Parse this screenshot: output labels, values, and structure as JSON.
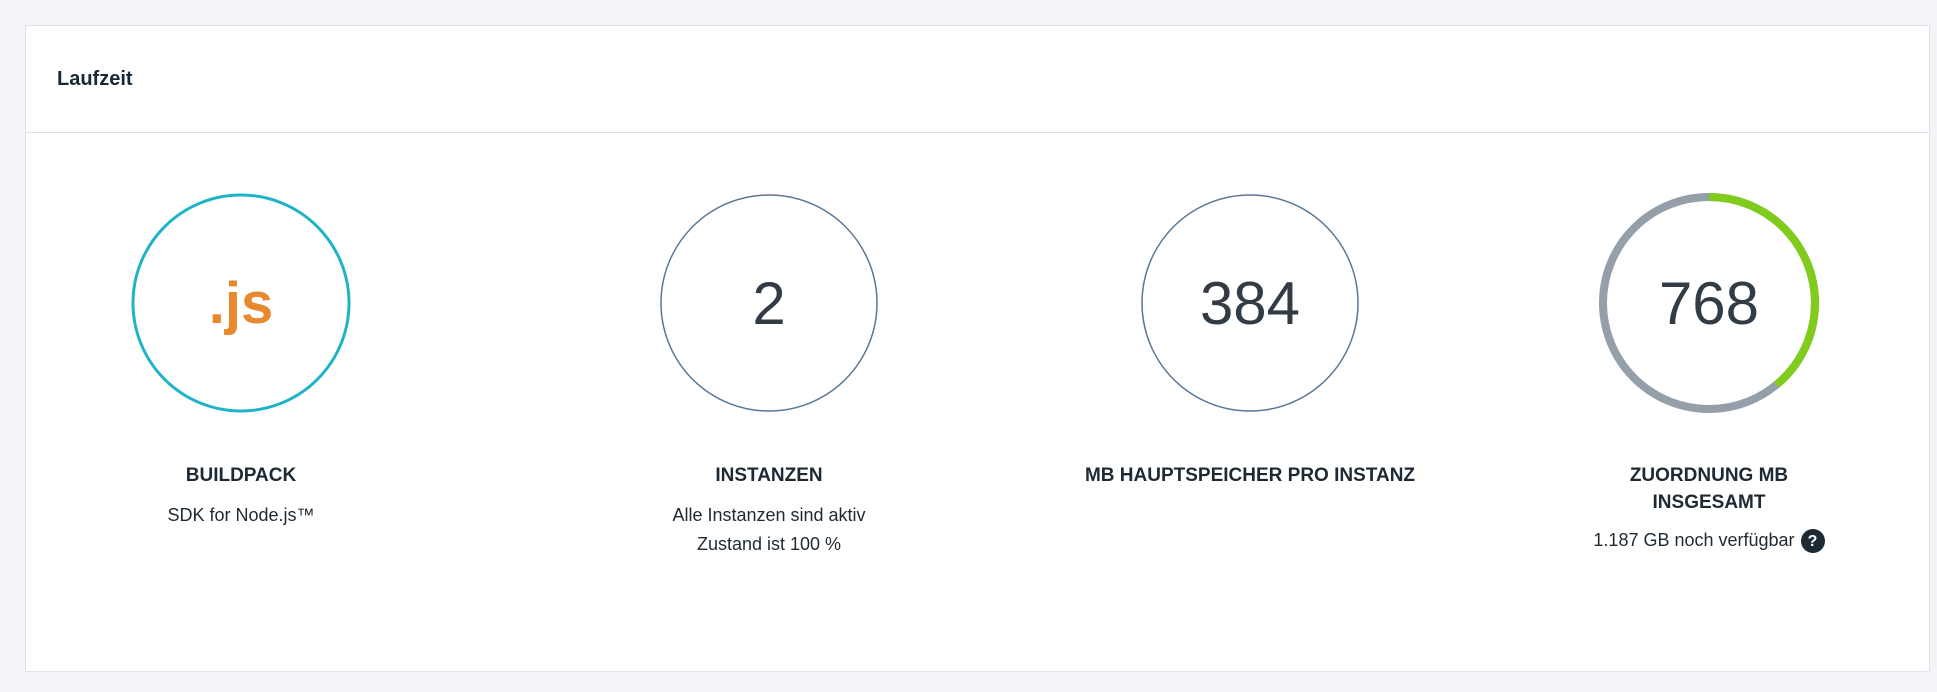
{
  "card": {
    "title": "Laufzeit"
  },
  "metrics": [
    {
      "value": ".js",
      "label": "BUILDPACK",
      "sub": [
        "SDK for Node.js™"
      ],
      "ring_color": "#1fb3c8"
    },
    {
      "value": "2",
      "label": "INSTANZEN",
      "sub": [
        "Alle Instanzen sind aktiv",
        "Zustand ist 100 %"
      ],
      "ring_color": "#5a7796"
    },
    {
      "value": "384",
      "label": "MB HAUPTSPEICHER PRO INSTANZ",
      "sub": [],
      "ring_color": "#5a7796"
    },
    {
      "value": "768",
      "label_lines": [
        "ZUORDNUNG MB",
        "INSGESAMT"
      ],
      "sub": [
        "1.187 GB noch verfügbar"
      ],
      "ring_color": "#959fa9",
      "ring_used_color": "#80cc1c",
      "used_fraction": 0.39,
      "help_icon": "question-circle-icon"
    }
  ]
}
